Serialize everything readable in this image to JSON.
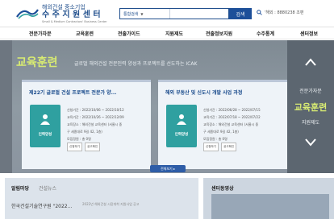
{
  "header": {
    "logo_line1": "해외건설 중소기업",
    "logo_line2": "수 주 지 원 센 터",
    "logo_line3": "Small & Medium Contractors' Business Center",
    "search_select": "통합검색",
    "search_button": "검색",
    "tel_text": "'해외 : 8880238 조편"
  },
  "nav": {
    "items": [
      "전문가자문",
      "교육훈련",
      "전출가이드",
      "지원제도",
      "전출정보지원",
      "수주통계",
      "센터정보"
    ]
  },
  "hero": {
    "title": "교육훈련",
    "subtitle": "글로벌 해외건설 전문인력 양성과 프로젝트를 선도하는 ICAK",
    "more_button": "전체보기 ▸",
    "side_items": [
      "전문가자문",
      "교육훈련",
      "지원제도"
    ],
    "cards": [
      {
        "title": "제22기 글로벌 건설 프로젝트 전문가 양...",
        "badge": "인력양성",
        "info": [
          "신청기간 : 2022/10/06 ~ 2022/10/12",
          "교육기간 : 2022/10/26 ~ 2022/12/09",
          "교육장소 : 해외건설 교육센터 (서울시 중",
          "구 세종대로 9길 42, 1층)",
          "모집정원 : 총 0명"
        ],
        "tags": [
          "신청하기",
          "공고확인"
        ]
      },
      {
        "title": "해외 부동산 및 신도시 개발 사업 과정",
        "badge": "인력양성",
        "info": [
          "신청기간 : 2022/06/28 ~ 2022/07/15",
          "교육기간 : 2022/07/18 ~ 2022/07/22",
          "교육장소 : 해외건설 교육센터 (서울시 중",
          "구 세종대로 9길 42, 1층)",
          "모집정원 : 총 0명"
        ],
        "tags": [
          "신청하기",
          "공고확인"
        ]
      }
    ]
  },
  "bottom": {
    "tab_active": "알림마당",
    "tab_inactive": "건설뉴스",
    "news_text": "한국건설기술연구원 \"2022...",
    "news_sub": "2022년 해외건설 시장개척 지원사업 공고",
    "center_title": "센터동영상"
  },
  "colors": {
    "brand_blue": "#1d4f99",
    "hero_accent": "#d8eb72",
    "badge_teal": "#2fa0a0"
  }
}
